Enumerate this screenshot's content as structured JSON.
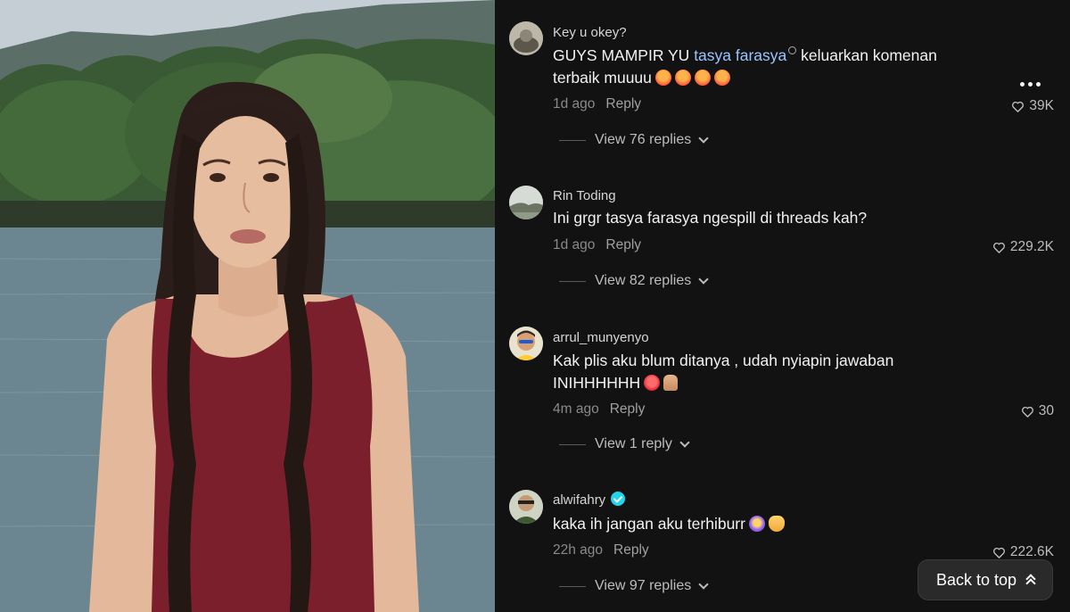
{
  "comments": [
    {
      "username": "Key u okey?",
      "verified": false,
      "text_before": "GUYS MAMPIR YU ",
      "mention": "tasya farasya",
      "text_after": " keluarkan komenan terbaik muuuu",
      "emojis": [
        "hot-face",
        "hot-face",
        "hot-face",
        "hot-face"
      ],
      "time": "1d ago",
      "reply_label": "Reply",
      "likes": "39K",
      "view_replies": "View 76 replies"
    },
    {
      "username": "Rin Toding",
      "verified": false,
      "text": "Ini grgr tasya farasya ngespill di threads kah?",
      "time": "1d ago",
      "reply_label": "Reply",
      "likes": "229.2K",
      "view_replies": "View 82 replies"
    },
    {
      "username": "arrul_munyenyo",
      "verified": false,
      "text_line1": "Kak plis aku blum ditanya , udah nyiapin jawaban",
      "text_line2": "INIHHHHHH",
      "emojis": [
        "angry-face",
        "praying-hands"
      ],
      "time": "4m ago",
      "reply_label": "Reply",
      "likes": "30",
      "view_replies": "View 1 reply"
    },
    {
      "username": "alwifahry",
      "verified": true,
      "text": "kaka ih jangan aku terhiburr",
      "emojis": [
        "star-struck",
        "heart-hands"
      ],
      "time": "22h ago",
      "reply_label": "Reply",
      "likes": "222.6K",
      "view_replies": "View 97 replies"
    }
  ],
  "back_to_top_label": "Back to top",
  "colors": {
    "panel_bg": "#121212",
    "mention": "#9bc4ff",
    "muted": "#8a8a8a",
    "verified": "#20d5ec"
  }
}
